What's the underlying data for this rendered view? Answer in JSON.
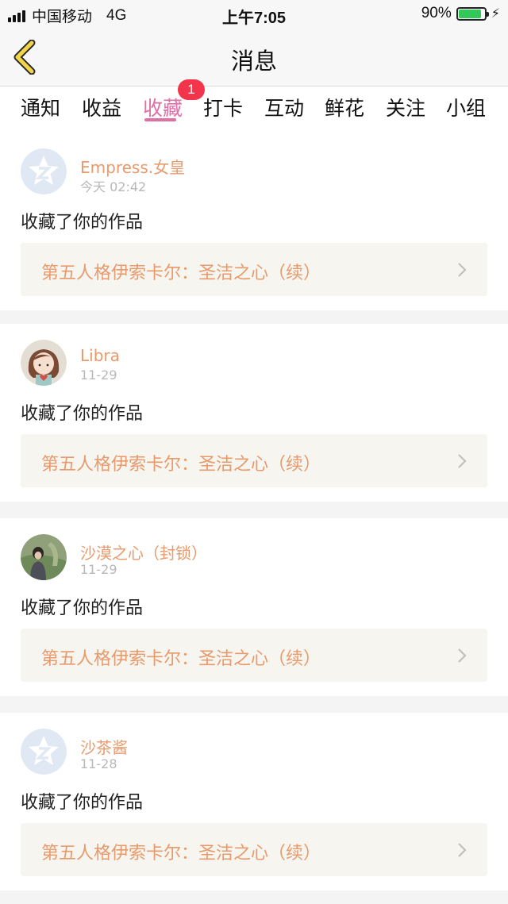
{
  "status_bar": {
    "carrier": "中国移动",
    "network": "4G",
    "time": "上午7:05",
    "battery": "90%",
    "battery_level": 0.9,
    "battery_color": "#34c759"
  },
  "header": {
    "title": "消息"
  },
  "tabs": [
    {
      "label": "通知"
    },
    {
      "label": "收益"
    },
    {
      "label": "收藏",
      "active": true,
      "badge": "1"
    },
    {
      "label": "打卡"
    },
    {
      "label": "互动"
    },
    {
      "label": "鲜花"
    },
    {
      "label": "关注"
    },
    {
      "label": "小组"
    }
  ],
  "colors": {
    "accent": "#e06fa5",
    "name": "#e89a6c",
    "badge": "#f2354a"
  },
  "feed": [
    {
      "user": "Empress.女皇",
      "time": "今天 02:42",
      "action": "收藏了你的作品",
      "work": "第五人格伊索卡尔：圣洁之心（续）",
      "avatar": "default-avatar-icon"
    },
    {
      "user": "Libra",
      "time": "11-29",
      "action": "收藏了你的作品",
      "work": "第五人格伊索卡尔：圣洁之心（续）",
      "avatar": "girl-avatar"
    },
    {
      "user": "沙漠之心（封锁）",
      "time": "11-29",
      "action": "收藏了你的作品",
      "work": "第五人格伊索卡尔：圣洁之心（续）",
      "avatar": "photo-avatar"
    },
    {
      "user": "沙茶酱",
      "time": "11-28",
      "action": "收藏了你的作品",
      "work": "第五人格伊索卡尔：圣洁之心（续）",
      "avatar": "default-avatar-icon"
    }
  ]
}
